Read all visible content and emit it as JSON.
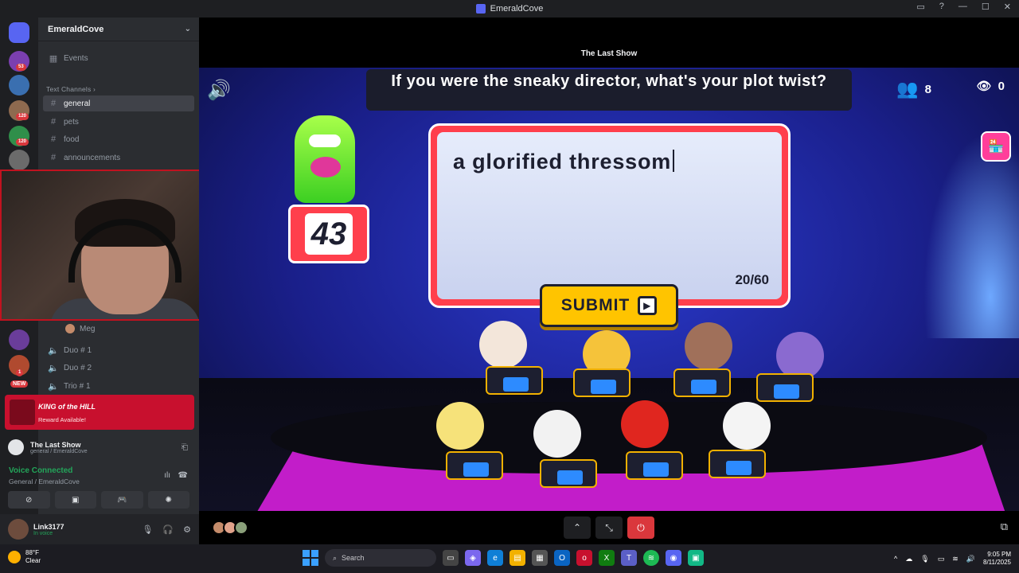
{
  "window": {
    "title": "EmeraldCove"
  },
  "server": {
    "name": "EmeraldCove",
    "badges": [
      "53",
      "120",
      "120",
      "1"
    ],
    "new_label": "NEW"
  },
  "channels": {
    "events": "Events",
    "category": "Text Channels",
    "items": [
      "general",
      "pets",
      "food",
      "announcements"
    ],
    "voice_user": "Meg",
    "voice_items": [
      "Duo # 1",
      "Duo # 2",
      "Trio # 1"
    ]
  },
  "promo": {
    "title": "KING of the HILL",
    "subtitle": "Reward Available!"
  },
  "activity_card": {
    "title": "The Last Show",
    "subtitle": "general / EmeraldCove"
  },
  "voice": {
    "status": "Voice Connected",
    "location": "General / EmeraldCove"
  },
  "user": {
    "name": "Link3177",
    "status": "In voice"
  },
  "stage": {
    "activity_title": "The Last Show"
  },
  "game": {
    "question": "If you were the sneaky director, what's your plot twist?",
    "answer": "a glorified thressom",
    "char_count": "20/60",
    "submit_label": "SUBMIT",
    "timer": "43",
    "players_count": "8",
    "viewers_count": "0"
  },
  "taskbar": {
    "weather_temp": "88°F",
    "weather_desc": "Clear",
    "search_placeholder": "Search",
    "time": "9:05 PM",
    "date": "8/11/2025"
  },
  "colors": {
    "accent": "#5865f2",
    "promo": "#c8102e",
    "answer_frame": "#ff3f4c",
    "submit": "#ffc400",
    "online": "#23a55a"
  }
}
